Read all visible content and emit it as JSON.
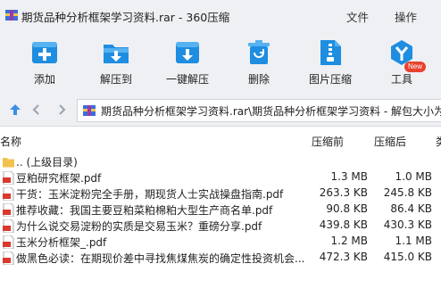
{
  "window": {
    "title": "期货品种分析框架学习资料.rar - 360压缩",
    "menu": {
      "file": "文件",
      "operation": "操作"
    }
  },
  "toolbar": {
    "add": "添加",
    "extract_to": "解压到",
    "one_click_extract": "一键解压",
    "delete": "删除",
    "image_compress": "图片压缩",
    "tools": "工具",
    "new_badge": "New"
  },
  "address": {
    "path": "期货品种分析框架学习资料.rar\\期货品种分析框架学习资料 - 解包大小为"
  },
  "columns": {
    "name": "名称",
    "size": "压缩前",
    "packed": "压缩后",
    "type": "类"
  },
  "parent_row": {
    "name": ".. (上级目录)"
  },
  "files": [
    {
      "name": "豆粕研究框架.pdf",
      "size": "1.3 MB",
      "packed": "1.0 MB"
    },
    {
      "name": "干货：玉米淀粉完全手册，期现货人士实战操盘指南.pdf",
      "size": "263.3 KB",
      "packed": "245.8 KB"
    },
    {
      "name": "推荐收藏：我国主要豆粕菜粕棉粕大型生产商名单.pdf",
      "size": "90.8 KB",
      "packed": "86.4 KB"
    },
    {
      "name": "为什么说交易淀粉的实质是交易玉米？重磅分享.pdf",
      "size": "439.8 KB",
      "packed": "430.3 KB"
    },
    {
      "name": "玉米分析框架_.pdf",
      "size": "1.2 MB",
      "packed": "1.1 MB"
    },
    {
      "name": "做黑色必读：在期现价差中寻找焦煤焦炭的确定性投资机会...",
      "size": "472.3 KB",
      "packed": "415.0 KB"
    }
  ],
  "colors": {
    "toolbar_bg": "#eef0f3",
    "icon_blue": "#1f8de0",
    "badge_red": "#e8412c",
    "pdf_red": "#d9382f",
    "folder_yellow": "#f2c24e"
  }
}
